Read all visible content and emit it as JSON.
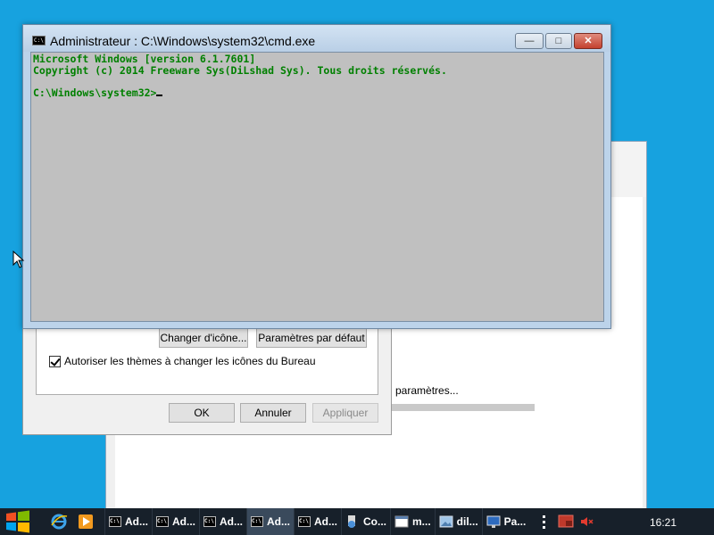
{
  "cmd_window": {
    "title": "Administrateur : C:\\Windows\\system32\\cmd.exe",
    "app_icon": "C:\\",
    "line1": "Microsoft Windows [version 6.1.7601]",
    "line2": "Copyright (c) 2014 Freeware Sys(DiLshad Sys). Tous droits réservés.",
    "prompt": "C:\\Windows\\system32>",
    "buttons": {
      "minimize": "—",
      "maximize": "□",
      "close": "✕"
    }
  },
  "desktop_icons_dialog": {
    "change_icon_button": "Changer d'icône...",
    "default_settings_button": "Paramètres par défaut",
    "allow_themes_checkbox": "Autoriser les thèmes à changer les icônes du Bureau",
    "ok_button": "OK",
    "cancel_button": "Annuler",
    "apply_button": "Appliquer"
  },
  "background_window": {
    "status_text": "paramètres..."
  },
  "taskbar": {
    "items": [
      {
        "label": "Ad...",
        "icon": "cmd-icon"
      },
      {
        "label": "Ad...",
        "icon": "cmd-icon"
      },
      {
        "label": "Ad...",
        "icon": "cmd-icon"
      },
      {
        "label": "Ad...",
        "icon": "cmd-icon"
      },
      {
        "label": "Ad...",
        "icon": "cmd-icon"
      },
      {
        "label": "Co...",
        "icon": "control-panel-icon"
      },
      {
        "label": "m...",
        "icon": "window-icon"
      },
      {
        "label": "dil...",
        "icon": "image-icon"
      },
      {
        "label": "Pa...",
        "icon": "monitor-icon"
      }
    ],
    "clock": "16:21"
  },
  "colors": {
    "desktop": "#17a2df",
    "console_background": "#c0c0c0",
    "console_text": "#008000",
    "taskbar": "#17202a"
  }
}
